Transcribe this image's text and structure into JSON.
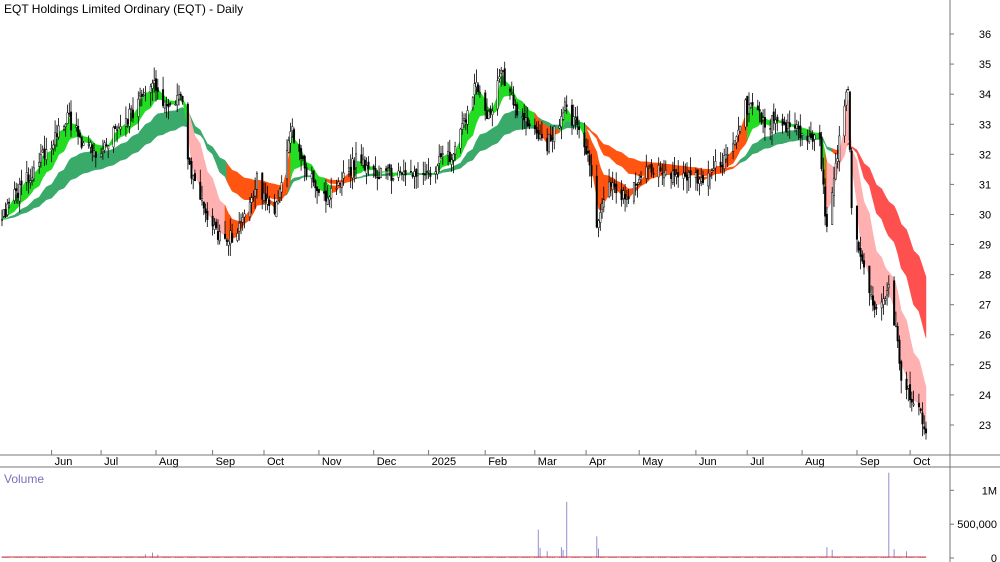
{
  "chart_data": {
    "type": "candlestick",
    "title": "EQT Holdings Limited Ordinary (EQT) - Daily",
    "volume_label": "Volume",
    "x_axis": {
      "start": "2024-05-06",
      "end": "2025-10-10",
      "tick_labels": [
        {
          "label": "Jun",
          "date": "2024-06-03"
        },
        {
          "label": "Jul",
          "date": "2024-07-01"
        },
        {
          "label": "Aug",
          "date": "2024-08-01"
        },
        {
          "label": "Sep",
          "date": "2024-09-02"
        },
        {
          "label": "Oct",
          "date": "2024-10-01"
        },
        {
          "label": "Nov",
          "date": "2024-11-01"
        },
        {
          "label": "Dec",
          "date": "2024-12-02"
        },
        {
          "label": "2025",
          "date": "2025-01-02"
        },
        {
          "label": "Feb",
          "date": "2025-02-03"
        },
        {
          "label": "Mar",
          "date": "2025-03-03"
        },
        {
          "label": "Apr",
          "date": "2025-04-01"
        },
        {
          "label": "May",
          "date": "2025-05-01"
        },
        {
          "label": "Jun",
          "date": "2025-06-02"
        },
        {
          "label": "Jul",
          "date": "2025-07-01"
        },
        {
          "label": "Aug",
          "date": "2025-08-01"
        },
        {
          "label": "Sep",
          "date": "2025-09-01"
        },
        {
          "label": "Oct",
          "date": "2025-10-01"
        }
      ]
    },
    "price_axis": {
      "range": [
        22.3,
        36.6
      ],
      "ticks": [
        23,
        24,
        25,
        26,
        27,
        28,
        29,
        30,
        31,
        32,
        33,
        34,
        35,
        36
      ]
    },
    "volume_axis": {
      "range": [
        0,
        1300000
      ],
      "ticks": [
        {
          "value": 0,
          "label": "0"
        },
        {
          "value": 500000,
          "label": "500,000"
        },
        {
          "value": 1000000,
          "label": "1M"
        }
      ]
    },
    "price_anchors": [
      [
        "2024-05-06",
        30.0
      ],
      [
        "2024-05-15",
        30.8
      ],
      [
        "2024-05-24",
        31.5
      ],
      [
        "2024-06-03",
        32.4
      ],
      [
        "2024-06-12",
        33.2
      ],
      [
        "2024-06-21",
        32.3
      ],
      [
        "2024-07-01",
        32.0
      ],
      [
        "2024-07-10",
        32.9
      ],
      [
        "2024-07-19",
        33.4
      ],
      [
        "2024-07-29",
        34.4
      ],
      [
        "2024-08-07",
        33.7
      ],
      [
        "2024-08-16",
        33.8
      ],
      [
        "2024-08-20",
        31.5
      ],
      [
        "2024-08-28",
        30.3
      ],
      [
        "2024-09-05",
        29.4
      ],
      [
        "2024-09-13",
        29.3
      ],
      [
        "2024-09-20",
        29.9
      ],
      [
        "2024-09-27",
        31.2
      ],
      [
        "2024-10-01",
        30.6
      ],
      [
        "2024-10-08",
        30.2
      ],
      [
        "2024-10-16",
        32.9
      ],
      [
        "2024-10-25",
        31.4
      ],
      [
        "2024-11-05",
        30.6
      ],
      [
        "2024-11-13",
        31.0
      ],
      [
        "2024-11-22",
        31.8
      ],
      [
        "2024-12-04",
        31.4
      ],
      [
        "2024-12-16",
        31.3
      ],
      [
        "2024-12-27",
        31.2
      ],
      [
        "2025-01-08",
        31.7
      ],
      [
        "2025-01-17",
        32.1
      ],
      [
        "2025-01-28",
        34.3
      ],
      [
        "2025-02-05",
        33.2
      ],
      [
        "2025-02-12",
        34.7
      ],
      [
        "2025-02-20",
        33.6
      ],
      [
        "2025-02-28",
        32.9
      ],
      [
        "2025-03-10",
        32.3
      ],
      [
        "2025-03-20",
        33.5
      ],
      [
        "2025-03-28",
        32.8
      ],
      [
        "2025-04-03",
        31.6
      ],
      [
        "2025-04-07",
        29.6
      ],
      [
        "2025-04-14",
        31.2
      ],
      [
        "2025-04-24",
        30.5
      ],
      [
        "2025-05-06",
        31.6
      ],
      [
        "2025-05-20",
        31.3
      ],
      [
        "2025-06-05",
        31.2
      ],
      [
        "2025-06-19",
        31.9
      ],
      [
        "2025-06-30",
        33.6
      ],
      [
        "2025-07-11",
        33.1
      ],
      [
        "2025-07-24",
        32.9
      ],
      [
        "2025-08-01",
        32.7
      ],
      [
        "2025-08-11",
        32.5
      ],
      [
        "2025-08-15",
        29.4
      ],
      [
        "2025-08-22",
        32.4
      ],
      [
        "2025-08-27",
        34.3
      ],
      [
        "2025-08-29",
        30.2
      ],
      [
        "2025-09-05",
        28.1
      ],
      [
        "2025-09-12",
        26.8
      ],
      [
        "2025-09-19",
        27.5
      ],
      [
        "2025-09-23",
        26.2
      ],
      [
        "2025-09-26",
        24.6
      ],
      [
        "2025-10-03",
        23.7
      ],
      [
        "2025-10-10",
        22.9
      ]
    ],
    "volume_spikes": [
      [
        "2024-07-26",
        55000
      ],
      [
        "2024-07-30",
        80000
      ],
      [
        "2024-08-02",
        50000
      ],
      [
        "2025-03-05",
        420000
      ],
      [
        "2025-03-06",
        150000
      ],
      [
        "2025-03-10",
        100000
      ],
      [
        "2025-03-18",
        160000
      ],
      [
        "2025-03-19",
        120000
      ],
      [
        "2025-03-21",
        830000
      ],
      [
        "2025-04-07",
        320000
      ],
      [
        "2025-04-08",
        140000
      ],
      [
        "2025-08-15",
        160000
      ],
      [
        "2025-08-18",
        120000
      ],
      [
        "2025-09-19",
        1260000
      ],
      [
        "2025-09-22",
        130000
      ],
      [
        "2025-09-29",
        100000
      ]
    ],
    "volume_ma_level": 15000,
    "ribbons": {
      "short_term": {
        "colors": {
          "up": "#22dd22",
          "down": "#ff5511"
        },
        "windows": [
          3,
          5,
          8,
          10,
          12,
          15
        ],
        "down_segments": [
          [
            "2024-08-19",
            "2024-10-15"
          ],
          [
            "2024-11-08",
            "2024-11-20"
          ],
          [
            "2025-03-02",
            "2025-03-14"
          ],
          [
            "2025-04-01",
            "2025-06-30"
          ],
          [
            "2025-08-14",
            "2025-10-10"
          ]
        ]
      },
      "long_term": {
        "colors": {
          "up": "#3aaa6a",
          "down": "#ff5511"
        },
        "windows": [
          30,
          35,
          40,
          45,
          50,
          60
        ],
        "down_segments": [
          [
            "2024-09-10",
            "2024-10-10"
          ],
          [
            "2024-11-05",
            "2024-11-20"
          ],
          [
            "2025-04-01",
            "2025-06-25"
          ],
          [
            "2025-08-18",
            "2025-10-10"
          ]
        ]
      },
      "falling_short": {
        "color": "#ffb0b0",
        "segments": [
          [
            "2024-08-19",
            "2024-09-06"
          ],
          [
            "2025-08-15",
            "2025-10-10"
          ]
        ]
      },
      "falling_long": {
        "color": "#ff5050",
        "segments": [
          [
            "2025-08-27",
            "2025-10-10"
          ]
        ]
      }
    },
    "colors": {
      "bull": "#ffffff",
      "bear": "#000000",
      "wick": "#000000",
      "volume_bar": "#8f8fcf",
      "volume_ma": "#e03030",
      "axis": "#777777"
    }
  }
}
